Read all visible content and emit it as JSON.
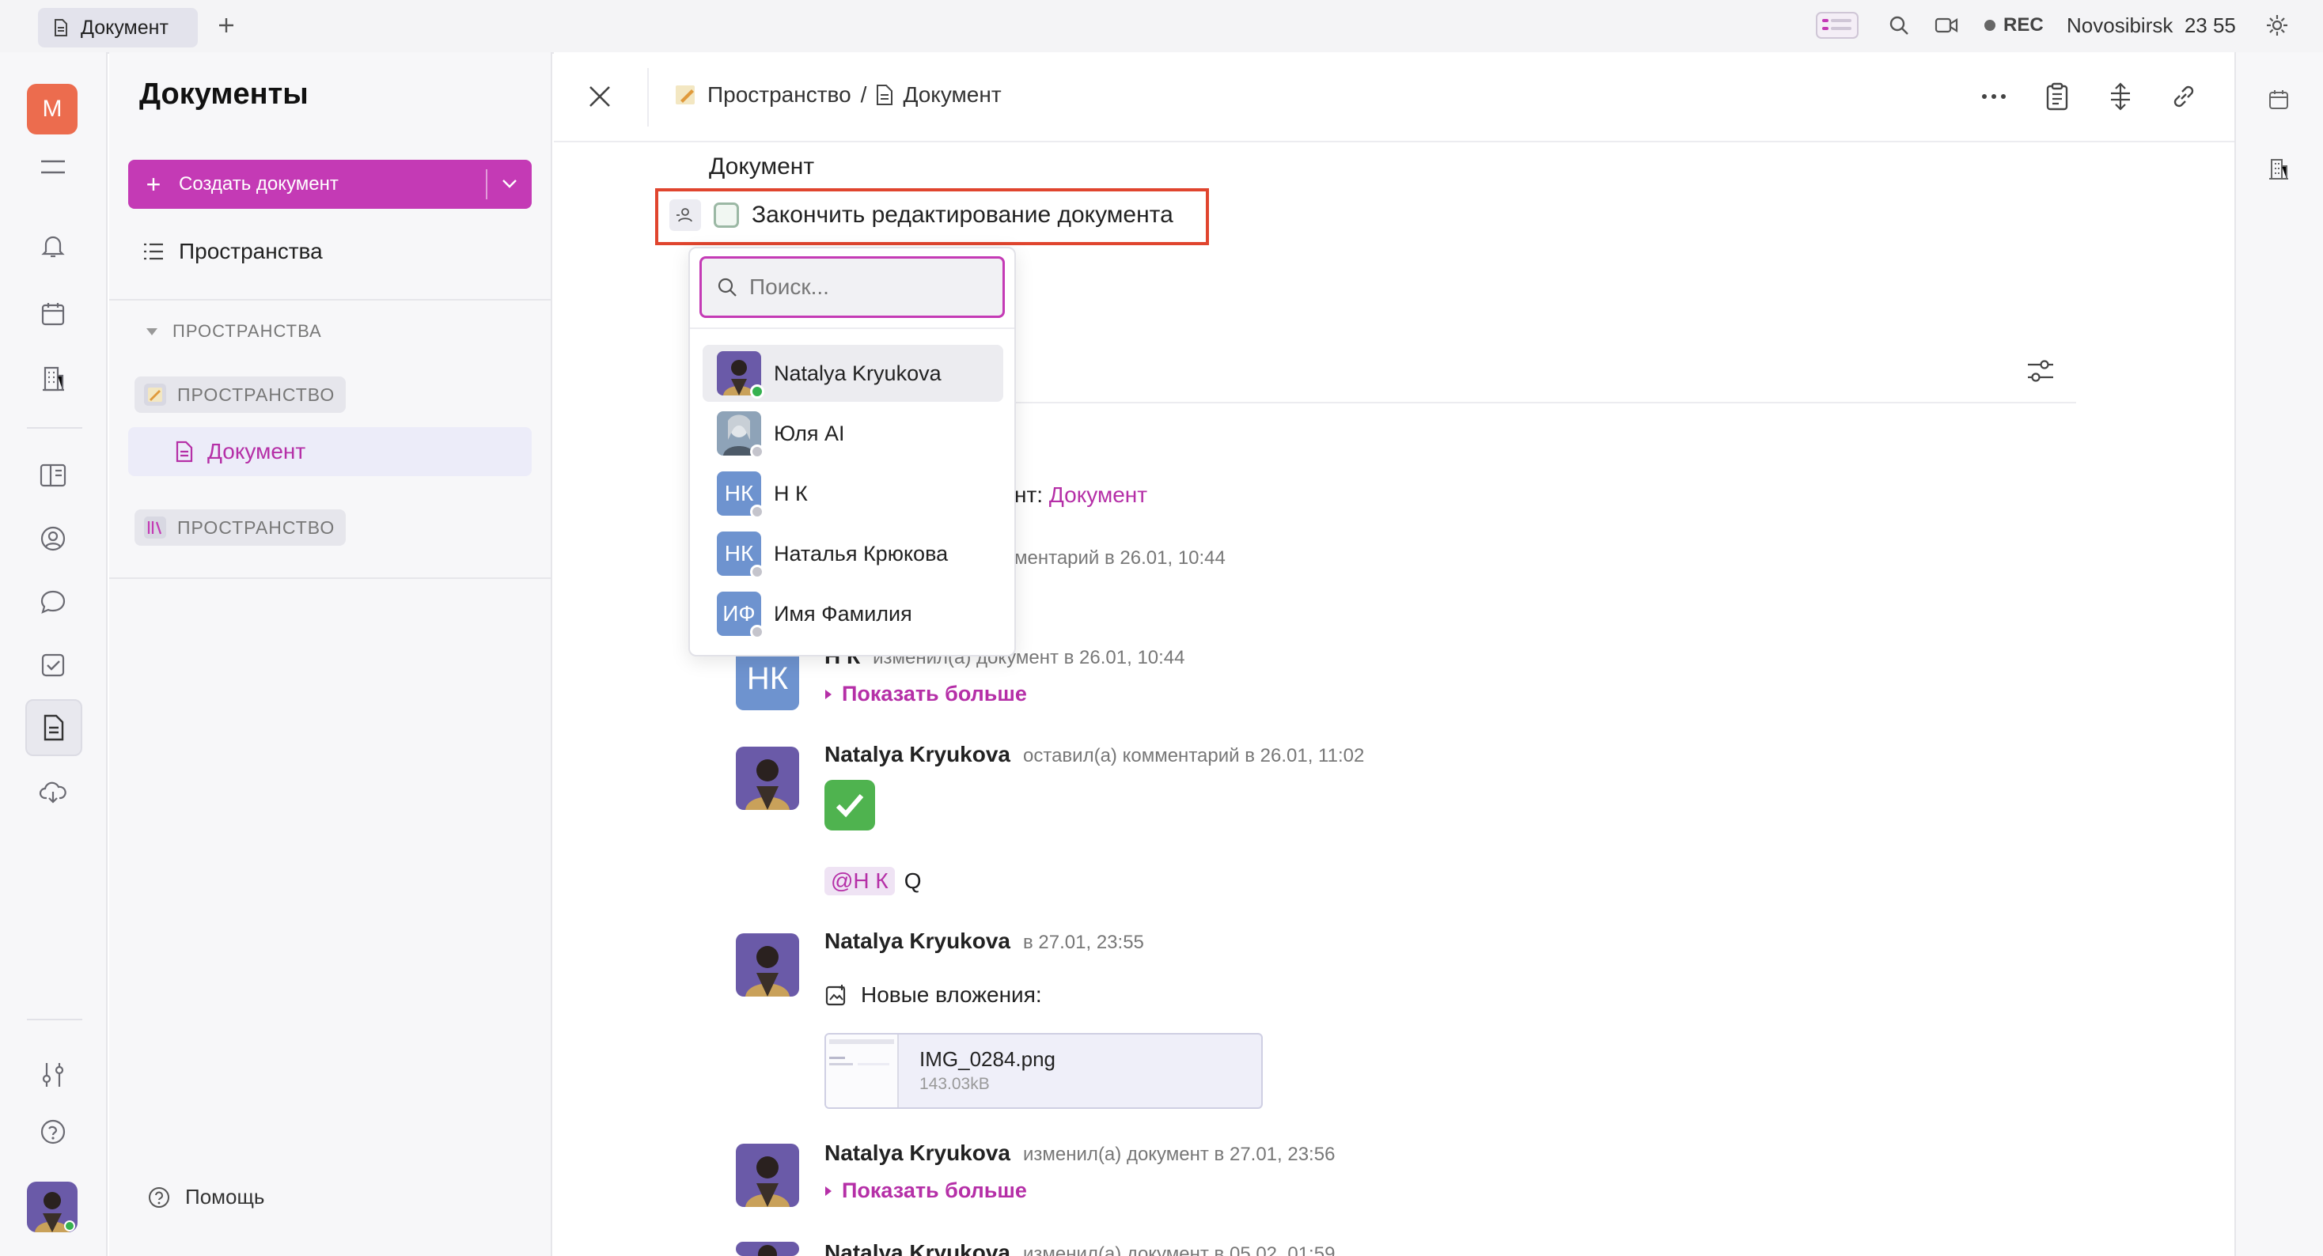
{
  "top_bar": {
    "tab_label": "Документ",
    "rec_label": "REC",
    "city": "Novosibirsk",
    "time": "23 55"
  },
  "rail": {
    "workspace_initial": "M"
  },
  "sidebar": {
    "title": "Документы",
    "create_button": "Создать документ",
    "spaces_link": "Пространства",
    "section_header": "ПРОСТРАНСТВА",
    "space_1": "ПРОСТРАНСТВО",
    "doc_item": "Документ",
    "space_2": "ПРОСТРАНСТВО",
    "help": "Помощь"
  },
  "header": {
    "breadcrumb_space": "Пространство",
    "breadcrumb_sep": "/",
    "breadcrumb_doc": "Документ"
  },
  "document": {
    "title": "Документ",
    "task_text": "Закончить редактирование документа"
  },
  "dropdown": {
    "search_placeholder": "Поиск...",
    "users": [
      {
        "name": "Natalya Kryukova",
        "initials": "",
        "status": "online"
      },
      {
        "name": "Юля AI",
        "initials": "",
        "status": "offline"
      },
      {
        "name": "Н К",
        "initials": "НК",
        "status": "offline"
      },
      {
        "name": "Наталья Крюкова",
        "initials": "НК",
        "status": "offline"
      },
      {
        "name": "Имя Фамилия",
        "initials": "ИФ",
        "status": "offline"
      }
    ]
  },
  "activity": {
    "partial_created_tail": "нт:",
    "partial_created_link": "Документ",
    "partial_comment_meta": "ментарий в 26.01, 10:44",
    "items": [
      {
        "name": "Н К",
        "initials": "НК",
        "meta": "изменил(а) документ в 26.01, 10:44",
        "show_more": "Показать больше"
      },
      {
        "name": "Natalya Kryukova",
        "meta": "оставил(а) комментарий в 26.01, 11:02",
        "mention": "@Н К",
        "text": "Q"
      },
      {
        "name": "Natalya Kryukova",
        "meta": "в 27.01, 23:55",
        "attachments_label": "Новые вложения:",
        "file_name": "IMG_0284.png",
        "file_size": "143.03kB"
      },
      {
        "name": "Natalya Kryukova",
        "meta": "изменил(а) документ в 27.01, 23:56",
        "show_more": "Показать больше"
      },
      {
        "name": "Natalya Kryukova",
        "meta": "изменил(а) документ в 05.02, 01:59"
      }
    ]
  },
  "colors": {
    "accent": "#c43ab5",
    "highlight_box": "#e0452e",
    "avatar_blue": "#6e93cf",
    "workspace_orange": "#ec6c4e",
    "online": "#35b14f"
  }
}
